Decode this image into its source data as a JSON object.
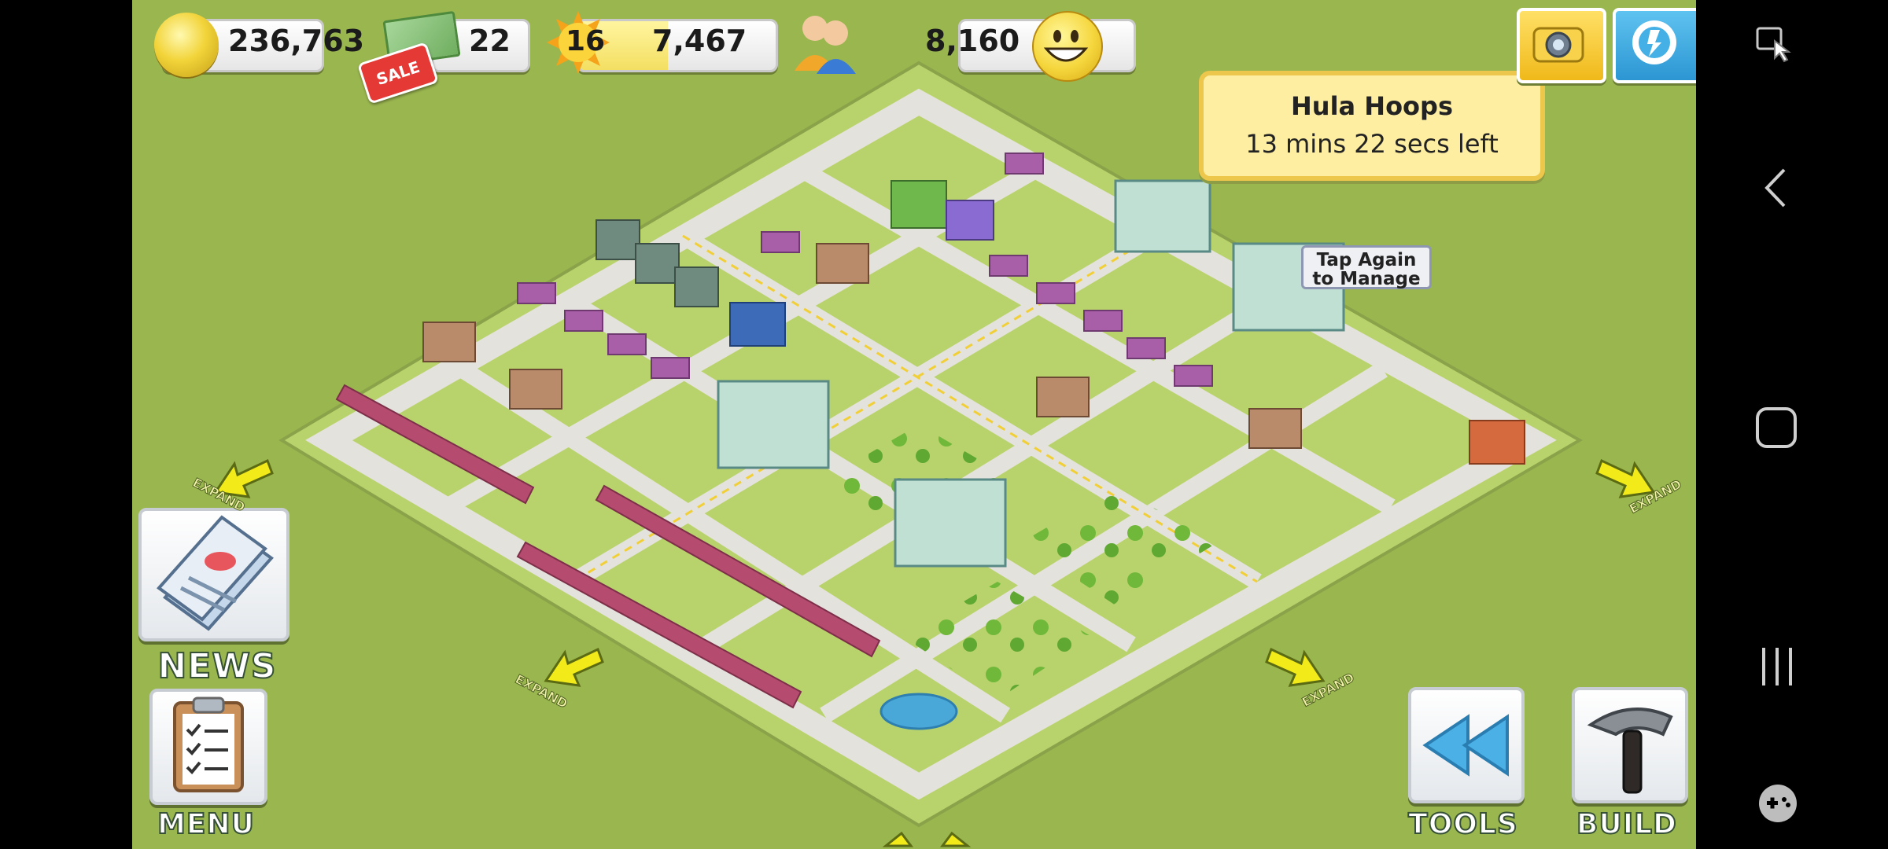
{
  "hud": {
    "coins": "236,763",
    "cash": "22",
    "sale_badge": "SALE",
    "level": "16",
    "experience": "7,467",
    "level_progress": 0.45,
    "population": "8,160"
  },
  "tooltip": {
    "title": "Hula Hoops",
    "subtitle": "13 mins 22 secs left"
  },
  "manage_hint": {
    "line1": "Tap Again",
    "line2": "to Manage"
  },
  "buttons": {
    "news": "NEWS",
    "menu": "MENU",
    "tools": "TOOLS",
    "build": "BUILD"
  },
  "expand_label": "EXPAND",
  "colors": {
    "grass": "#9ab64f",
    "road": "#e4e2dc",
    "tooltip_bg": "#fdeea2",
    "tooltip_border": "#ecc74c",
    "accent_blue": "#4aa8d8"
  },
  "icons": [
    "coin-icon",
    "cash-icon",
    "sale-tag-icon",
    "sun-level-icon",
    "population-icon",
    "happiness-smiley-icon",
    "camera-icon",
    "neighbors-icon",
    "newspaper-icon",
    "clipboard-icon",
    "rewind-icon",
    "hammer-icon",
    "screenshot-icon",
    "back-icon",
    "home-icon",
    "recents-icon",
    "game-launcher-icon"
  ]
}
